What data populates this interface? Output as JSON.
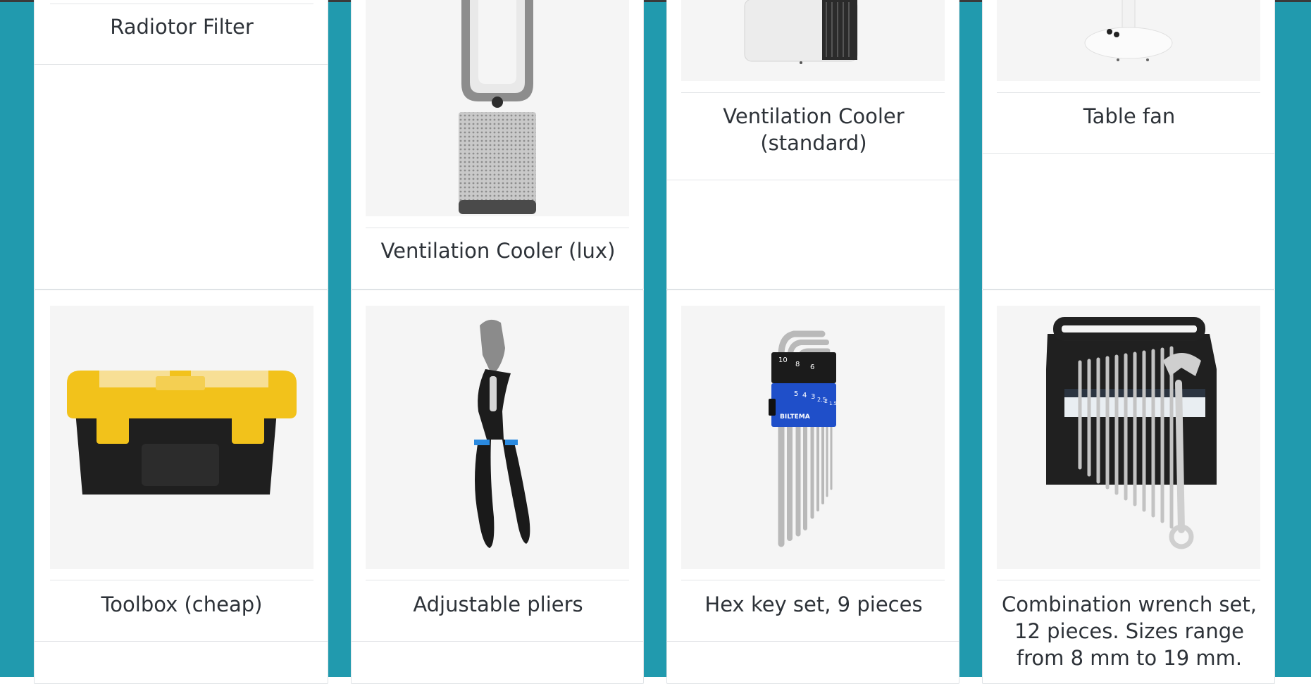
{
  "colors": {
    "background": "#219aae",
    "card": "#ffffff",
    "image_bg": "#f5f5f5",
    "text": "#2d3238"
  },
  "products": [
    {
      "name": "Radiotor Filter",
      "icon": "radiator-filter-icon"
    },
    {
      "name": "Ventilation Cooler (lux)",
      "icon": "tower-purifier-fan-icon"
    },
    {
      "name": "Ventilation Cooler (standard)",
      "icon": "portable-air-cooler-icon"
    },
    {
      "name": "Table fan",
      "icon": "table-fan-icon"
    },
    {
      "name": "Toolbox (cheap)",
      "icon": "toolbox-icon"
    },
    {
      "name": "Adjustable pliers",
      "icon": "pliers-icon"
    },
    {
      "name": "Hex key set, 9 pieces",
      "icon": "hex-key-set-icon"
    },
    {
      "name": "Combination wrench set, 12 pieces. Sizes range from 8 mm to 19 mm.",
      "icon": "wrench-set-icon"
    }
  ],
  "product_image_text": {
    "hex_sizes": [
      "10",
      "8",
      "6",
      "5",
      "4",
      "3",
      "2.5",
      "2",
      "1.5"
    ],
    "hex_brand": "BILTEMA"
  }
}
